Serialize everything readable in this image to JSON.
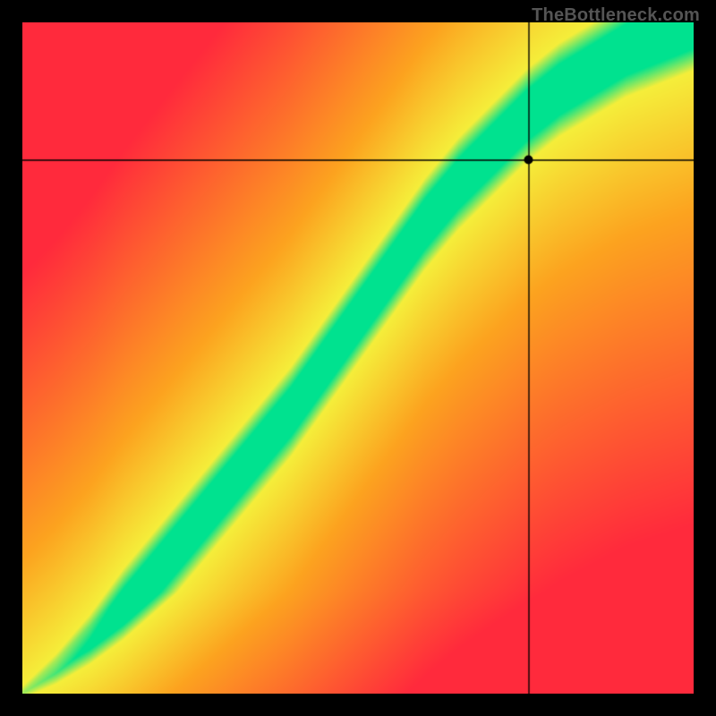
{
  "watermark": "TheBottleneck.com",
  "chart_data": {
    "type": "heatmap",
    "title": "",
    "xlabel": "",
    "ylabel": "",
    "xlim": [
      0,
      1
    ],
    "ylim": [
      0,
      1
    ],
    "crosshair": {
      "x": 0.755,
      "y": 0.795
    },
    "marker": {
      "x": 0.755,
      "y": 0.795
    },
    "ridge": [
      {
        "x": 0.0,
        "y": 0.0
      },
      {
        "x": 0.05,
        "y": 0.03
      },
      {
        "x": 0.1,
        "y": 0.07
      },
      {
        "x": 0.15,
        "y": 0.12
      },
      {
        "x": 0.2,
        "y": 0.18
      },
      {
        "x": 0.25,
        "y": 0.24
      },
      {
        "x": 0.3,
        "y": 0.3
      },
      {
        "x": 0.35,
        "y": 0.36
      },
      {
        "x": 0.4,
        "y": 0.42
      },
      {
        "x": 0.45,
        "y": 0.49
      },
      {
        "x": 0.5,
        "y": 0.56
      },
      {
        "x": 0.55,
        "y": 0.63
      },
      {
        "x": 0.6,
        "y": 0.7
      },
      {
        "x": 0.65,
        "y": 0.76
      },
      {
        "x": 0.7,
        "y": 0.81
      },
      {
        "x": 0.75,
        "y": 0.86
      },
      {
        "x": 0.8,
        "y": 0.9
      },
      {
        "x": 0.85,
        "y": 0.93
      },
      {
        "x": 0.9,
        "y": 0.96
      },
      {
        "x": 0.95,
        "y": 0.98
      },
      {
        "x": 1.0,
        "y": 1.0
      }
    ],
    "band_width": 0.055,
    "colors": {
      "best": "#00e28f",
      "good": "#f5ee3a",
      "mid": "#fca31f",
      "bad": "#ff2a3c"
    }
  }
}
